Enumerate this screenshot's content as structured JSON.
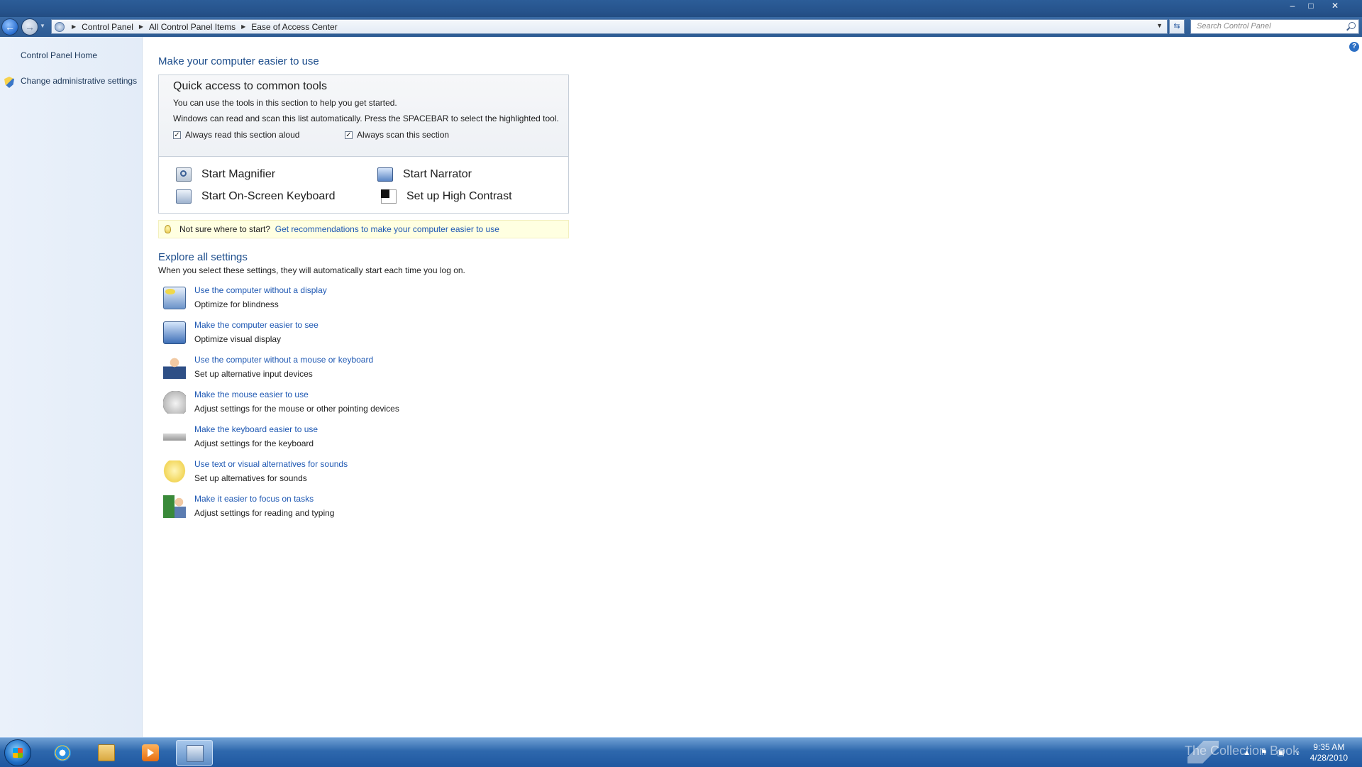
{
  "window": {
    "minimize": "–",
    "maximize": "□",
    "close": "✕"
  },
  "nav": {
    "back_glyph": "←",
    "forward_glyph": "→",
    "breadcrumbs": [
      "Control Panel",
      "All Control Panel Items",
      "Ease of Access Center"
    ],
    "search_placeholder": "Search Control Panel"
  },
  "sidebar": {
    "items": [
      {
        "label": "Control Panel Home"
      },
      {
        "label": "Change administrative settings"
      }
    ]
  },
  "help_glyph": "?",
  "main": {
    "title": "Make your computer easier to use",
    "quick_access": {
      "title": "Quick access to common tools",
      "line1": "You can use the tools in this section to help you get started.",
      "line2": "Windows can read and scan this list automatically.  Press the SPACEBAR to select the highlighted tool.",
      "read_aloud_label": "Always read this section aloud",
      "scan_label": "Always scan this section",
      "read_aloud_checked": true,
      "scan_checked": true,
      "check_glyph": "✓",
      "tools": {
        "magnifier": "Start Magnifier",
        "narrator": "Start Narrator",
        "keyboard": "Start On-Screen Keyboard",
        "contrast": "Set up High Contrast"
      }
    },
    "tip": {
      "text": "Not sure where to start?",
      "link": "Get recommendations to make your computer easier to use"
    },
    "explore": {
      "title": "Explore all settings",
      "description": "When you select these settings, they will automatically start each time you log on.",
      "settings": [
        {
          "link": "Use the computer without a display",
          "desc": "Optimize for blindness",
          "icon": "display-icon"
        },
        {
          "link": "Make the computer easier to see",
          "desc": "Optimize visual display",
          "icon": "monitor-icon"
        },
        {
          "link": "Use the computer without a mouse or keyboard",
          "desc": "Set up alternative input devices",
          "icon": "person-icon"
        },
        {
          "link": "Make the mouse easier to use",
          "desc": "Adjust settings for the mouse or other pointing devices",
          "icon": "mouse-icon"
        },
        {
          "link": "Make the keyboard easier to use",
          "desc": "Adjust settings for the keyboard",
          "icon": "keyboard-icon"
        },
        {
          "link": "Use text or visual alternatives for sounds",
          "desc": "Set up alternatives for sounds",
          "icon": "speech-bubble-icon"
        },
        {
          "link": "Make it easier to focus on tasks",
          "desc": "Adjust settings for reading and typing",
          "icon": "focus-icon"
        }
      ]
    }
  },
  "taskbar": {
    "watermark": "The Collection Book",
    "tray_glyphs": {
      "expand": "▲",
      "flag": "⚑",
      "network": "▣",
      "volume": "♪"
    },
    "clock_time": "9:35 AM",
    "clock_date": "4/28/2010"
  }
}
